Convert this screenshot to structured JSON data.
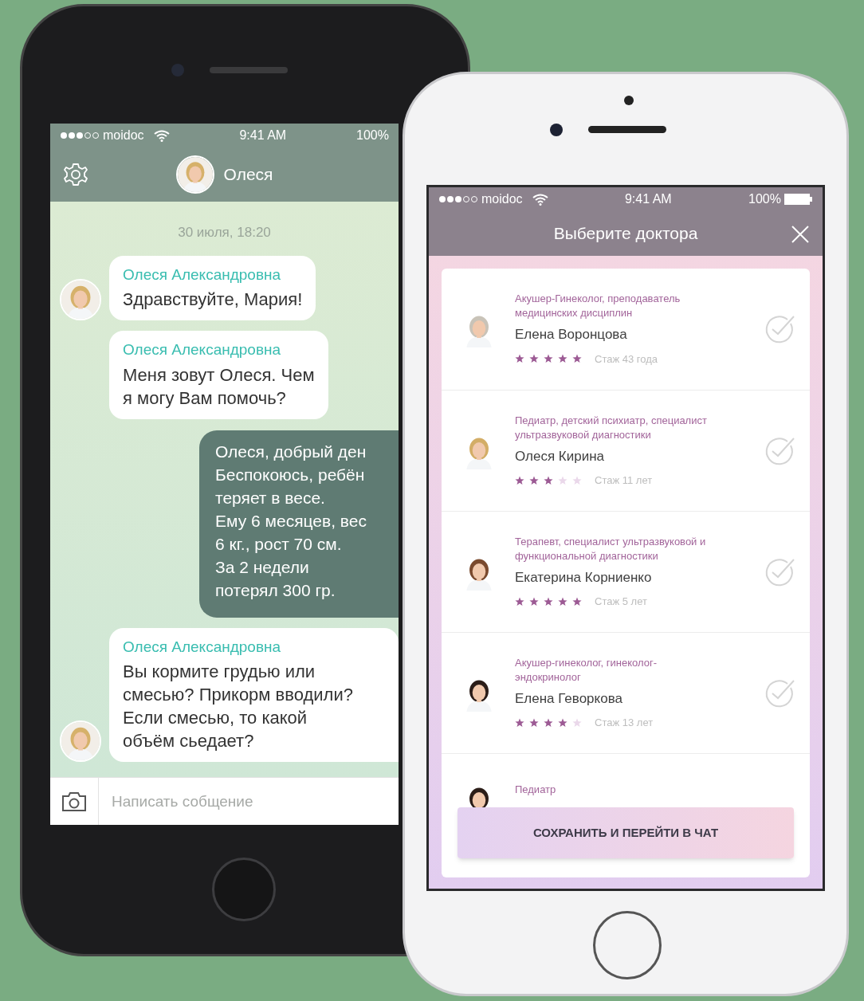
{
  "chat_screen": {
    "status_bar": {
      "carrier": "moidoc",
      "time": "9:41 AM",
      "battery": "100%"
    },
    "header": {
      "contact": "Олеся"
    },
    "date": "30 июля, 18:20",
    "messages": [
      {
        "kind": "incoming",
        "sender": "Олеся Александровна",
        "lines": [
          "Здравствуйте, Мария!"
        ],
        "avatar": true
      },
      {
        "kind": "incoming",
        "sender": "Олеся Александровна",
        "lines": [
          "Меня зовут Олеся. Чем",
          "я могу Вам помочь?"
        ],
        "avatar": false
      },
      {
        "kind": "outgoing",
        "lines": [
          "Олеся, добрый ден",
          "Беспокоюсь, ребён",
          "теряет в весе.",
          "Ему 6 месяцев, вес",
          "6 кг., рост 70 см.",
          "За 2 недели",
          "потерял 300 гр."
        ]
      },
      {
        "kind": "incoming",
        "sender": "Олеся Александровна",
        "lines": [
          "Вы кормите грудью или",
          "смесью? Прикорм вводили?",
          "Если смесью, то какой",
          "объём сьедает?"
        ],
        "avatar": true
      }
    ],
    "composer": {
      "placeholder": "Написать собщение"
    }
  },
  "doctor_screen": {
    "status_bar": {
      "carrier": "moidoc",
      "time": "9:41 AM",
      "battery": "100%"
    },
    "title": "Выберите доктора",
    "doctors": [
      {
        "specialty": "Акушер-Гинеколог, преподаватель медицинских дисциплин",
        "name": "Елена Воронцова",
        "stars": 5,
        "experience": "Стаж 43 года",
        "selected": false
      },
      {
        "specialty": "Педиатр, детский психиатр, специалист ультразвуковой диагностики",
        "name": "Олеся Кирина",
        "stars": 3,
        "experience": "Стаж 11 лет",
        "selected": false
      },
      {
        "specialty": "Терапевт, специалист ультразвуковой и функциональной диагностики",
        "name": "Екатерина Корниенко",
        "stars": 5,
        "experience": "Стаж 5 лет",
        "selected": false
      },
      {
        "specialty": "Акушер-гинеколог, гинеколог-эндокринолог",
        "name": "Елена Геворкова",
        "stars": 4,
        "experience": "Стаж 13 лет",
        "selected": false
      },
      {
        "specialty": "Педиатр"
      }
    ],
    "save_button": "СОХРАНИТЬ И ПЕРЕЙТИ В ЧАТ"
  }
}
